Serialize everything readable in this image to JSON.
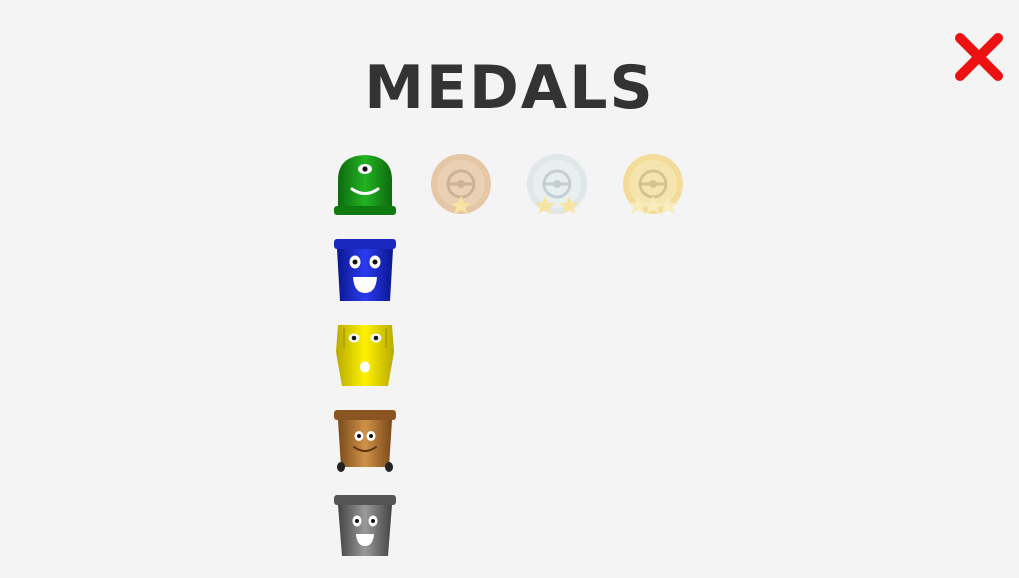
{
  "screen": {
    "title": "MEDALS"
  },
  "icons": {
    "close": "close-x-icon",
    "medals": [
      "bronze-medal-icon",
      "silver-medal-icon",
      "gold-medal-icon"
    ]
  },
  "bins": [
    {
      "name": "green",
      "color": "#1a9a1a",
      "medals_earned": 0
    },
    {
      "name": "blue",
      "color": "#1f2fd6",
      "medals_earned": 0
    },
    {
      "name": "yellow",
      "color": "#f0e000",
      "medals_earned": 0
    },
    {
      "name": "brown",
      "color": "#b87a3a",
      "medals_earned": 0
    },
    {
      "name": "gray",
      "color": "#777777",
      "medals_earned": 0
    }
  ],
  "medal_tiers": [
    {
      "name": "bronze",
      "stars": 1,
      "color": "#d4914a"
    },
    {
      "name": "silver",
      "stars": 2,
      "color": "#c8d8dc"
    },
    {
      "name": "gold",
      "stars": 3,
      "color": "#f2c12e"
    }
  ],
  "colors": {
    "close": "#ee1111",
    "title": "#333333",
    "background": "#f4f4f4"
  }
}
